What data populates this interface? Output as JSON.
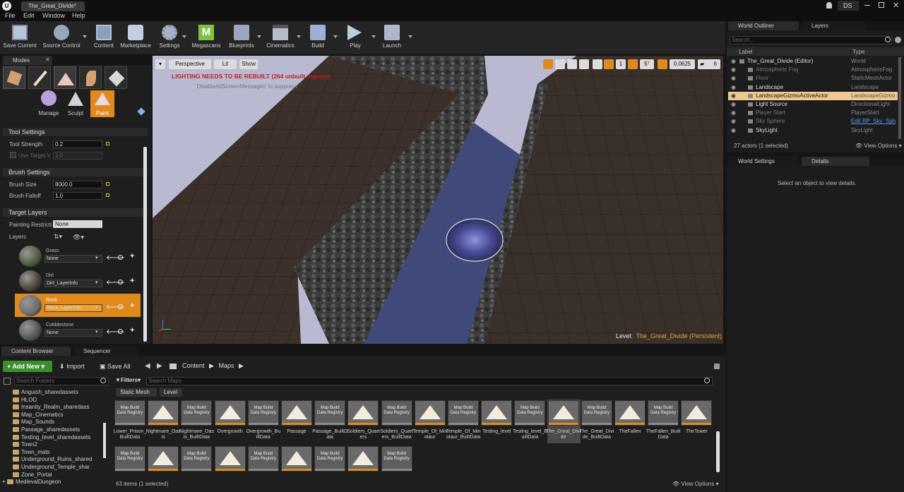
{
  "window": {
    "tab_title": "The_Great_Divide*",
    "user_initials": "DS"
  },
  "menu": [
    "File",
    "Edit",
    "Window",
    "Help"
  ],
  "toolbar": [
    {
      "label": "Save Current",
      "icon": "save-icon"
    },
    {
      "label": "Source Control",
      "icon": "source-control-icon"
    },
    {
      "label": "Content",
      "icon": "content-icon"
    },
    {
      "label": "Marketplace",
      "icon": "marketplace-icon"
    },
    {
      "label": "Settings",
      "icon": "gear-icon"
    },
    {
      "label": "Megascans",
      "icon": "megascans-icon"
    },
    {
      "label": "Blueprints",
      "icon": "blueprints-icon"
    },
    {
      "label": "Cinematics",
      "icon": "cinematics-icon"
    },
    {
      "label": "Build",
      "icon": "build-icon"
    },
    {
      "label": "Play",
      "icon": "play-icon"
    },
    {
      "label": "Launch",
      "icon": "launch-icon"
    }
  ],
  "modes": {
    "tab": "Modes",
    "tools": [
      "Manage",
      "Sculpt",
      "Paint"
    ],
    "active_tool": "Paint",
    "tool_settings": {
      "header": "Tool Settings",
      "tool_strength_label": "Tool Strength",
      "tool_strength": "0.2",
      "use_target_label": "Use Target V",
      "use_target_value": "1.0"
    },
    "brush_settings": {
      "header": "Brush Settings",
      "size_label": "Brush Size",
      "size": "8000.0",
      "falloff_label": "Brush Falloff",
      "falloff": "1.0"
    },
    "target_layers": {
      "header": "Target Layers",
      "restriction_label": "Painting Restricti",
      "restriction": "None",
      "layers_label": "Layers",
      "layers": [
        {
          "name": "Grass",
          "info": "None",
          "color": "#4a5a36"
        },
        {
          "name": "Dirt",
          "info": "Dirt_LayerInfo",
          "color": "#4a3f30"
        },
        {
          "name": "Rock",
          "info": "Rock_LayerInfo",
          "color": "#6a6a6a"
        },
        {
          "name": "Cobblestone",
          "info": "None",
          "color": "#4e5552"
        }
      ],
      "selected_layer": "Rock"
    }
  },
  "viewport": {
    "perspective": "Perspective",
    "lit": "Lit",
    "show": "Show",
    "warning": "LIGHTING NEEDS TO BE REBUILT (264 unbuilt objects)",
    "suppress_hint": "'DisableAllScreenMessages' to suppress",
    "grid_value": "1",
    "angle_value": "5°",
    "scale_value": "0.0625",
    "camera_speed": "6",
    "level_prefix": "Level:",
    "level_name": "The_Great_Divide (Persistent)"
  },
  "outliner": {
    "tab": "World Outliner",
    "layers_tab": "Layers",
    "search_placeholder": "Search...",
    "col_label": "Label",
    "col_type": "Type",
    "rows": [
      {
        "label": "The_Great_Divide (Editor)",
        "type": "World"
      },
      {
        "label": "Atmospheric Fog",
        "type": "AtmosphericFog"
      },
      {
        "label": "Floor",
        "type": "StaticMeshActor"
      },
      {
        "label": "Landscape",
        "type": "Landscape"
      },
      {
        "label": "LandscapeGizmoActiveActor",
        "type": "LandscapeGizmo"
      },
      {
        "label": "Light Source",
        "type": "DirectionalLight"
      },
      {
        "label": "Player Start",
        "type": "PlayerStart"
      },
      {
        "label": "Sky Sphere",
        "type": "Edit BP_Sky_Sph"
      },
      {
        "label": "SkyLight",
        "type": "SkyLight"
      }
    ],
    "actor_count": "27 actors (1 selected)",
    "view_options": "View Options"
  },
  "details": {
    "world_settings_tab": "World Settings",
    "details_tab": "Details",
    "empty_message": "Select an object to view details."
  },
  "content_browser": {
    "tab": "Content Browser",
    "sequencer_tab": "Sequencer",
    "add_new": "Add New",
    "import": "Import",
    "save_all": "Save All",
    "path": [
      "Content",
      "Maps"
    ],
    "search_folders_placeholder": "Search Folders",
    "filters": "Filters",
    "search_maps_placeholder": "Search Maps",
    "filter_chips": [
      "Static Mesh",
      "Level"
    ],
    "folders": [
      "Anguish_sharedassets",
      "HLOD",
      "Insanity_Realm_sharedass",
      "Map_Cinematics",
      "Map_Sounds",
      "Passage_sharedassets",
      "Testing_level_sharedassets",
      "Town2",
      "Town_mats",
      "Underground_Ruins_shared",
      "Underground_Temple_shar",
      "Zone_Portal",
      "MedievalDungeon"
    ],
    "assets_row1": [
      {
        "name": "Lower_Prison_BuiltData",
        "kind": "registry"
      },
      {
        "name": "Nightmare_Oasis",
        "kind": "map"
      },
      {
        "name": "Nightmare_Oasis_BuiltData",
        "kind": "registry"
      },
      {
        "name": "Overgrowth",
        "kind": "map"
      },
      {
        "name": "Overgrowth_BuiltData",
        "kind": "registry"
      },
      {
        "name": "Passage",
        "kind": "map"
      },
      {
        "name": "Passage_BuiltData",
        "kind": "registry"
      },
      {
        "name": "Soldiers_Quarters",
        "kind": "map"
      },
      {
        "name": "Soldiers_Quarters_BuiltData",
        "kind": "registry"
      },
      {
        "name": "Temple_Of_Minotaur",
        "kind": "map"
      },
      {
        "name": "Temple_Of_Minotaur_BuiltData",
        "kind": "registry"
      },
      {
        "name": "Testing_level",
        "kind": "map"
      },
      {
        "name": "Testing_level_BuiltData",
        "kind": "registry"
      },
      {
        "name": "The_Great_Divide",
        "kind": "map"
      },
      {
        "name": "The_Great_Divide_BuiltData",
        "kind": "registry"
      },
      {
        "name": "TheFallen",
        "kind": "map"
      },
      {
        "name": "TheFallen_BuiltData",
        "kind": "registry"
      },
      {
        "name": "TheTower",
        "kind": "map"
      }
    ],
    "assets_row2_kinds": [
      "registry",
      "map",
      "registry",
      "map",
      "registry",
      "map",
      "registry",
      "map",
      "registry"
    ],
    "registry_caption": "Map Build Data Registry",
    "selected_asset": "The_Great_Divide",
    "item_count": "63 items (1 selected)",
    "view_options": "View Options"
  }
}
